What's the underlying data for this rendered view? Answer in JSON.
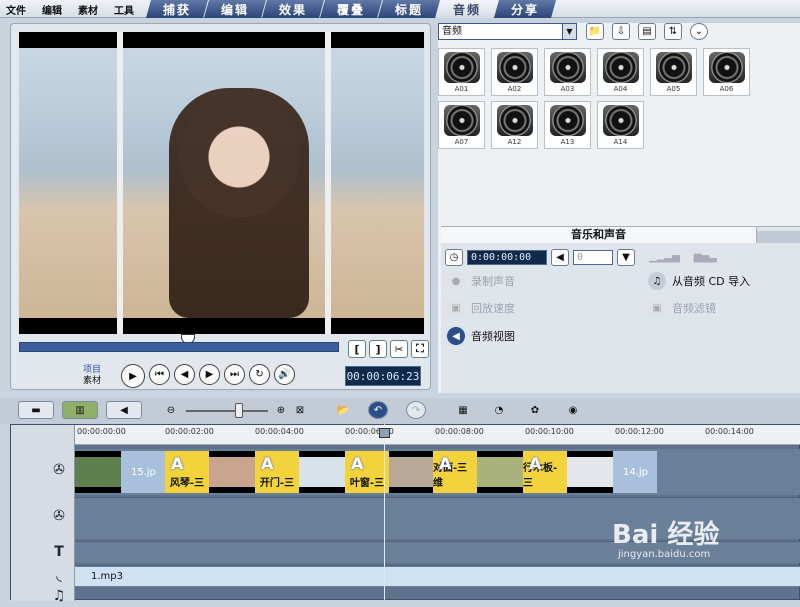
{
  "menu": [
    "文件",
    "编辑",
    "素材",
    "工具"
  ],
  "tabs": [
    {
      "label": "捕获",
      "active": false
    },
    {
      "label": "编辑",
      "active": false
    },
    {
      "label": "效果",
      "active": false
    },
    {
      "label": "覆叠",
      "active": false
    },
    {
      "label": "标题",
      "active": false
    },
    {
      "label": "音频",
      "active": true
    },
    {
      "label": "分享",
      "active": false
    }
  ],
  "player": {
    "mode_project": "项目",
    "mode_clip": "素材",
    "timecode": "00:00:06:23",
    "trim_start": "[",
    "trim_end": "]",
    "cut": "✂",
    "fullscreen": "⛶",
    "controls": [
      "▶",
      "⏮",
      "◀",
      "▶",
      "⏭",
      "↻",
      "🔊"
    ]
  },
  "library": {
    "category": "音频",
    "items": [
      "A01",
      "A02",
      "A03",
      "A04",
      "A05",
      "A06",
      "A07",
      "A12",
      "A13",
      "A14"
    ]
  },
  "music_panel": {
    "title": "音乐和声音",
    "duration": "0:00:00:00",
    "volume": "0",
    "record_voice": "录制声音",
    "import_cd": "从音频 CD 导入",
    "playback_speed": "回放速度",
    "audio_filter": "音频滤镜",
    "audio_view": "音频视图"
  },
  "timeline": {
    "ruler": [
      "00:00:00:00",
      "00:00:02:00",
      "00:00:04:00",
      "00:00:06:00",
      "00:00:08:00",
      "00:00:10:00",
      "00:00:12:00",
      "00:00:14:00"
    ],
    "clips": {
      "gap1": "15.jp",
      "tr1": "风琴-三",
      "tr2": "开门-三",
      "tr3": "叶窗-三",
      "tr4": "对面-三维",
      "tr5": "行木板-三",
      "gap2": "14.jp",
      "transition_icon": "A"
    },
    "audio_clip": "1.mp3"
  },
  "watermark": {
    "text": "Bai 经验",
    "url": "jingyan.baidu.com"
  }
}
